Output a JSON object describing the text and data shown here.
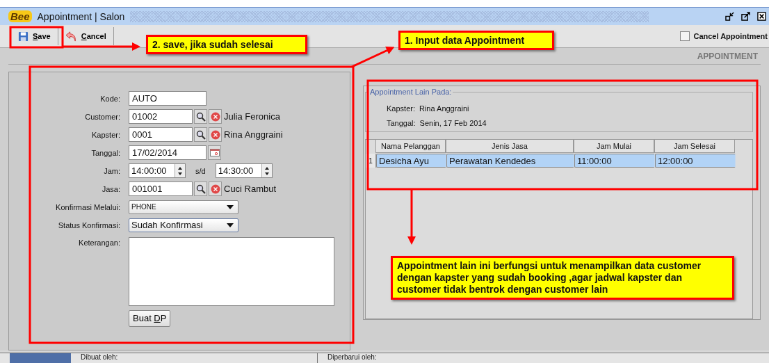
{
  "window": {
    "logo": "Bee",
    "title": "Appointment | Salon"
  },
  "toolbar": {
    "buttons": [
      {
        "kind": "save",
        "underline": "S",
        "rest": "ave"
      },
      {
        "kind": "cancel",
        "underline": "C",
        "rest": "ancel"
      }
    ],
    "cancel_appointment": {
      "label": "Cancel Appointment",
      "checked": false
    }
  },
  "section_title": "APPOINTMENT",
  "form": {
    "fields": [
      {
        "kind": "text",
        "label": "Kode:",
        "value": "AUTO"
      },
      {
        "kind": "lookup",
        "label": "Customer:",
        "value": "01002",
        "name": "Julia Feronica"
      },
      {
        "kind": "lookup",
        "label": "Kapster:",
        "value": "0001",
        "name": "Rina Anggraini"
      },
      {
        "kind": "date",
        "label": "Tanggal:",
        "value": "17/02/2014"
      },
      {
        "kind": "time-range",
        "label": "Jam:",
        "value": "14:00:00",
        "separator": "s/d",
        "value_end": "14:30:00"
      },
      {
        "kind": "lookup",
        "label": "Jasa:",
        "value": "001001",
        "name": "Cuci Rambut"
      },
      {
        "kind": "select",
        "label": "Konfirmasi Melalui:",
        "value": "PHONE",
        "focused": false
      },
      {
        "kind": "select",
        "label": "Status Konfirmasi:",
        "value": "Sudah Konfirmasi",
        "focused": true
      },
      {
        "kind": "textarea",
        "label": "Keterangan:"
      }
    ],
    "dp_button": {
      "underline_start": "Buat ",
      "underline": "D",
      "underline_end": "P"
    }
  },
  "other_appointments": {
    "title": "Appointment Lain Pada:",
    "info": [
      {
        "label": "Kapster:",
        "value": "Rina Anggraini"
      },
      {
        "label": "Tanggal:",
        "value": "Senin, 17 Feb 2014"
      }
    ],
    "table": {
      "columns": [
        "Nama Pelanggan",
        "Jenis Jasa",
        "Jam Mulai",
        "Jam Selesai"
      ],
      "rows": [
        {
          "number": "1",
          "selected": true,
          "cells": [
            "Desicha Ayu",
            "Perawatan Kendedes",
            "11:00:00",
            "12:00:00"
          ]
        }
      ]
    }
  },
  "status_bar": {
    "created_label": "Dibuat oleh:",
    "updated_label": "Diperbarui oleh:"
  },
  "annotations": [
    {
      "kind": "save",
      "text": "2. save, jika sudah selesai"
    },
    {
      "kind": "input",
      "text": "1. Input data Appointment"
    },
    {
      "kind": "note",
      "text": "Appointment lain ini berfungsi untuk menampilkan data customer dengan kapster yang sudah booking ,agar jadwal kapster dan customer tidak bentrok dengan customer lain"
    }
  ]
}
